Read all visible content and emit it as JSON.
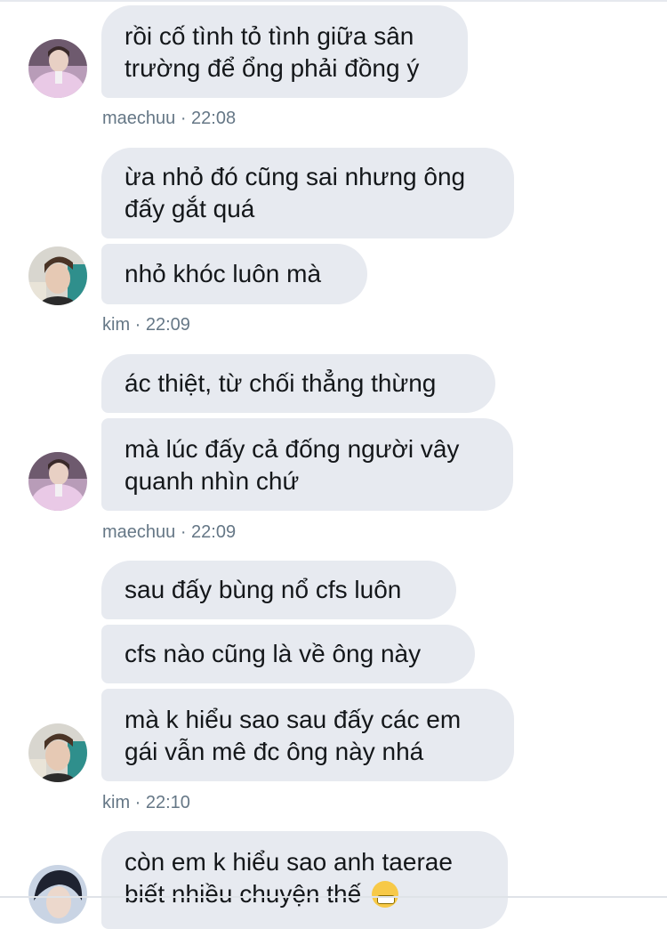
{
  "messages": [
    {
      "lines": [
        "rồi cố tình tỏ tình giữa sân",
        "trường để ổng phải đồng ý"
      ]
    },
    {
      "lines": [
        "ừa nhỏ đó cũng sai nhưng ông",
        "đấy gắt quá"
      ]
    },
    {
      "lines": [
        "nhỏ khóc luôn mà"
      ]
    },
    {
      "lines": [
        "ác thiệt, từ chối thẳng thừng"
      ]
    },
    {
      "lines": [
        "mà lúc đấy cả đống người vây",
        "quanh nhìn chứ"
      ]
    },
    {
      "lines": [
        "sau đấy bùng nổ cfs luôn"
      ]
    },
    {
      "lines": [
        "cfs nào cũng là về ông này"
      ]
    },
    {
      "lines": [
        "mà k hiểu sao sau đấy các em",
        "gái vẫn mê đc ông này nhá"
      ]
    },
    {
      "lines": [
        "còn em k hiểu sao anh taerae",
        "biết nhiều chuyện thế"
      ]
    }
  ],
  "meta": [
    {
      "text": "maechuu · 22:08"
    },
    {
      "text": "kim · 22:09"
    },
    {
      "text": "maechuu · 22:09"
    },
    {
      "text": "kim · 22:10"
    }
  ],
  "colors": {
    "bubble": "#e7eaf0",
    "text": "#14171a",
    "meta": "#657786"
  },
  "icons": {
    "emoji": "grimacing-face-emoji"
  }
}
